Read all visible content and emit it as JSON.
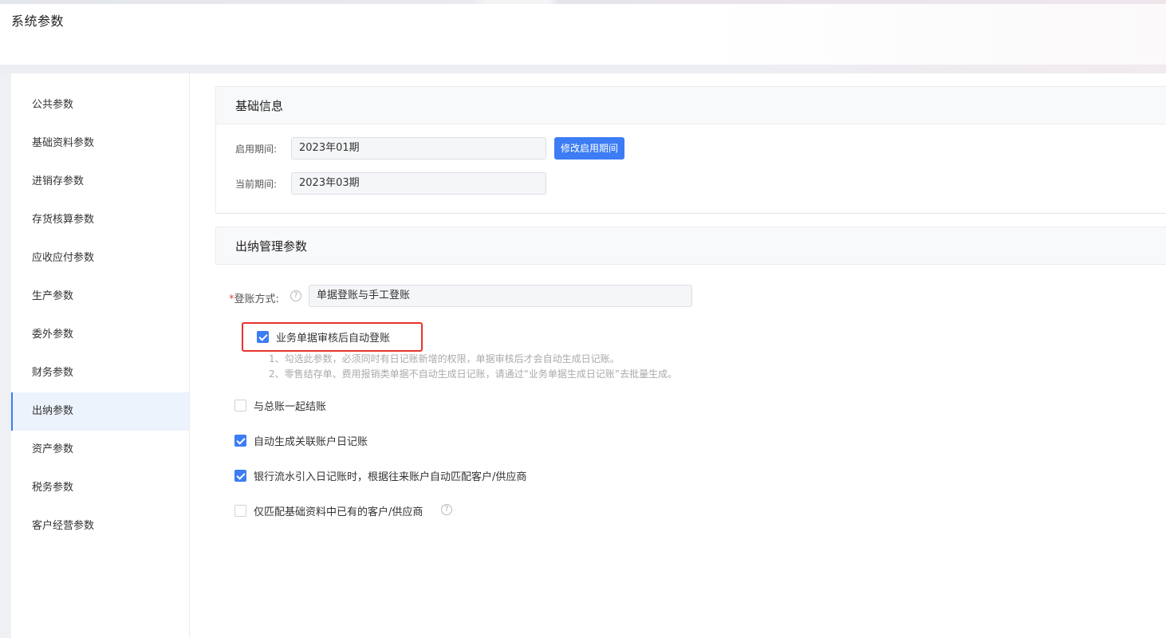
{
  "page": {
    "title": "系统参数"
  },
  "sidebar": {
    "items": [
      {
        "label": "公共参数",
        "active": false
      },
      {
        "label": "基础资料参数",
        "active": false
      },
      {
        "label": "进销存参数",
        "active": false
      },
      {
        "label": "存货核算参数",
        "active": false
      },
      {
        "label": "应收应付参数",
        "active": false
      },
      {
        "label": "生产参数",
        "active": false
      },
      {
        "label": "委外参数",
        "active": false
      },
      {
        "label": "财务参数",
        "active": false
      },
      {
        "label": "出纳参数",
        "active": true
      },
      {
        "label": "资产参数",
        "active": false
      },
      {
        "label": "税务参数",
        "active": false
      },
      {
        "label": "客户经营参数",
        "active": false
      }
    ]
  },
  "basic_info": {
    "title": "基础信息",
    "start_period_label": "启用期间:",
    "start_period_value": "2023年01期",
    "change_button": "修改启用期间",
    "current_period_label": "当前期间:",
    "current_period_value": "2023年03期"
  },
  "cashier": {
    "title": "出纳管理参数",
    "posting_method_required": "*",
    "posting_method_label": "登账方式:",
    "posting_method_help": "?",
    "posting_method_value": "单据登账与手工登账",
    "options": [
      {
        "label": "业务单据审核后自动登账",
        "checked": true
      },
      {
        "label": "与总账一起结账",
        "checked": false
      },
      {
        "label": "自动生成关联账户日记账",
        "checked": true
      },
      {
        "label": "银行流水引入日记账时，根据往来账户自动匹配客户/供应商",
        "checked": true
      },
      {
        "label": "仅匹配基础资料中已有的客户/供应商",
        "checked": false
      }
    ],
    "notes": [
      "1、勾选此参数，必须同时有日记账新增的权限，单据审核后才会自动生成日记账。",
      "2、零售结存单、费用报销类单据不自动生成日记账，请通过“业务单据生成日记账”去批量生成。"
    ],
    "last_option_help": "?"
  },
  "colors": {
    "primary": "#3c7cf4",
    "highlight": "#e8322c",
    "required": "#e74c3c"
  }
}
